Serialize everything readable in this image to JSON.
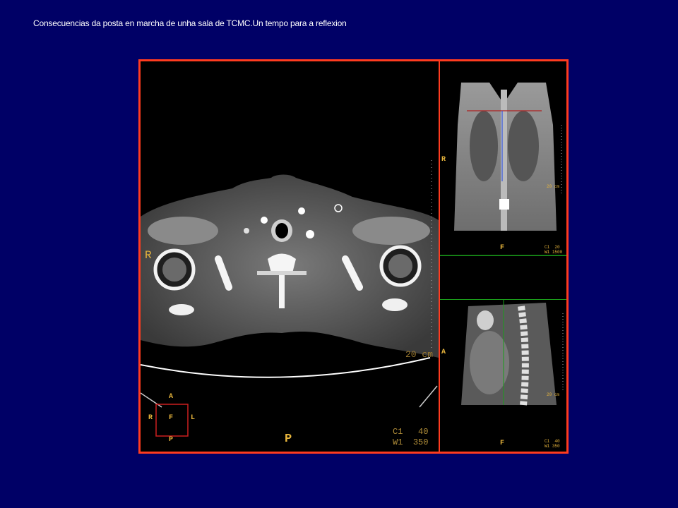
{
  "slide": {
    "title": "Consecuencias da posta en marcha de unha sala de TCMC.Un tempo para a reflexion"
  },
  "colors": {
    "background": "#000066",
    "frame": "#ff3b1f",
    "annotation": "#e6b43c"
  },
  "axial": {
    "side_label": "R",
    "bottom_label": "P",
    "scale": "20 cm",
    "wl": {
      "c_label": "C1",
      "c_value": "40",
      "w_label": "W1",
      "w_value": "350"
    },
    "orientation": {
      "a": "A",
      "r": "R",
      "f": "F",
      "l": "L",
      "p": "P"
    }
  },
  "coronal": {
    "side_label": "R",
    "bottom_label": "F",
    "scale": "20 cm",
    "wl": {
      "c_label": "C1",
      "c_value": "20",
      "w_label": "W1",
      "w_value": "1500"
    }
  },
  "sagittal": {
    "side_label": "A",
    "bottom_label": "F",
    "scale": "20 cm",
    "wl": {
      "c_label": "C1",
      "c_value": "40",
      "w_label": "W1",
      "w_value": "350"
    }
  }
}
